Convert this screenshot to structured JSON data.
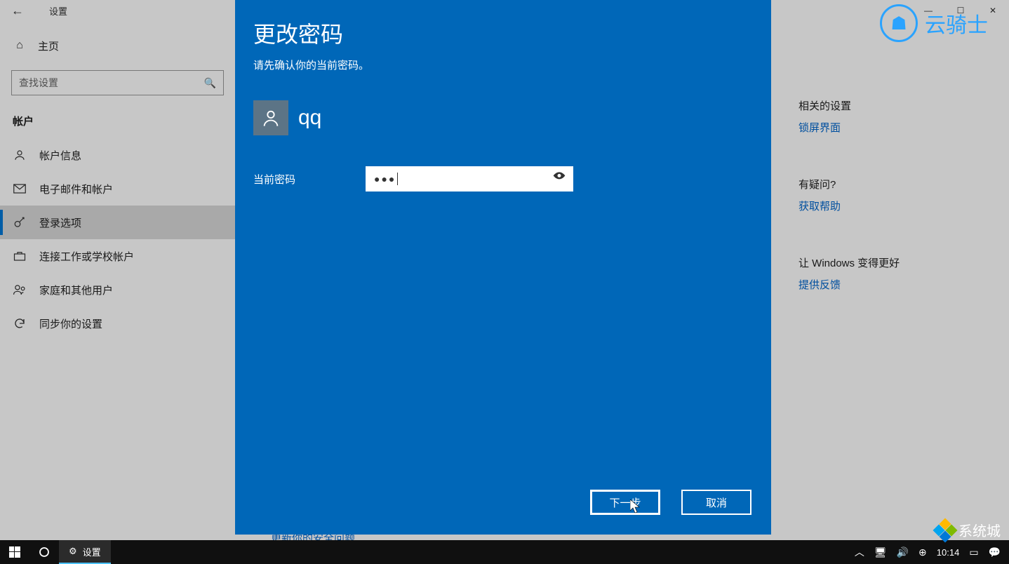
{
  "window": {
    "title": "设置",
    "back_icon": "←",
    "controls": {
      "min": "—",
      "max": "☐",
      "close": "✕"
    }
  },
  "sidebar": {
    "home_label": "主页",
    "search_placeholder": "查找设置",
    "section": "帐户",
    "items": [
      {
        "icon": "👤",
        "label": "帐户信息"
      },
      {
        "icon": "✉",
        "label": "电子邮件和帐户"
      },
      {
        "icon": "🔑",
        "label": "登录选项"
      },
      {
        "icon": "💼",
        "label": "连接工作或学校帐户"
      },
      {
        "icon": "👪",
        "label": "家庭和其他用户"
      },
      {
        "icon": "⟳",
        "label": "同步你的设置"
      }
    ],
    "active_index": 2
  },
  "right_panel": {
    "related_heading": "相关的设置",
    "related_link": "锁屏界面",
    "question_heading": "有疑问?",
    "help_link": "获取帮助",
    "better_heading": "让 Windows 变得更好",
    "feedback_link": "提供反馈"
  },
  "brand": {
    "name": "云骑士"
  },
  "cut_text": "更新你的安全问题",
  "modal": {
    "title": "更改密码",
    "subtitle": "请先确认你的当前密码。",
    "user_name": "qq",
    "field_label": "当前密码",
    "password_value": "●●●",
    "next_label": "下一步",
    "cancel_label": "取消"
  },
  "taskbar": {
    "app_label": "设置",
    "time": "10:14"
  },
  "sys_brand": "系统城"
}
